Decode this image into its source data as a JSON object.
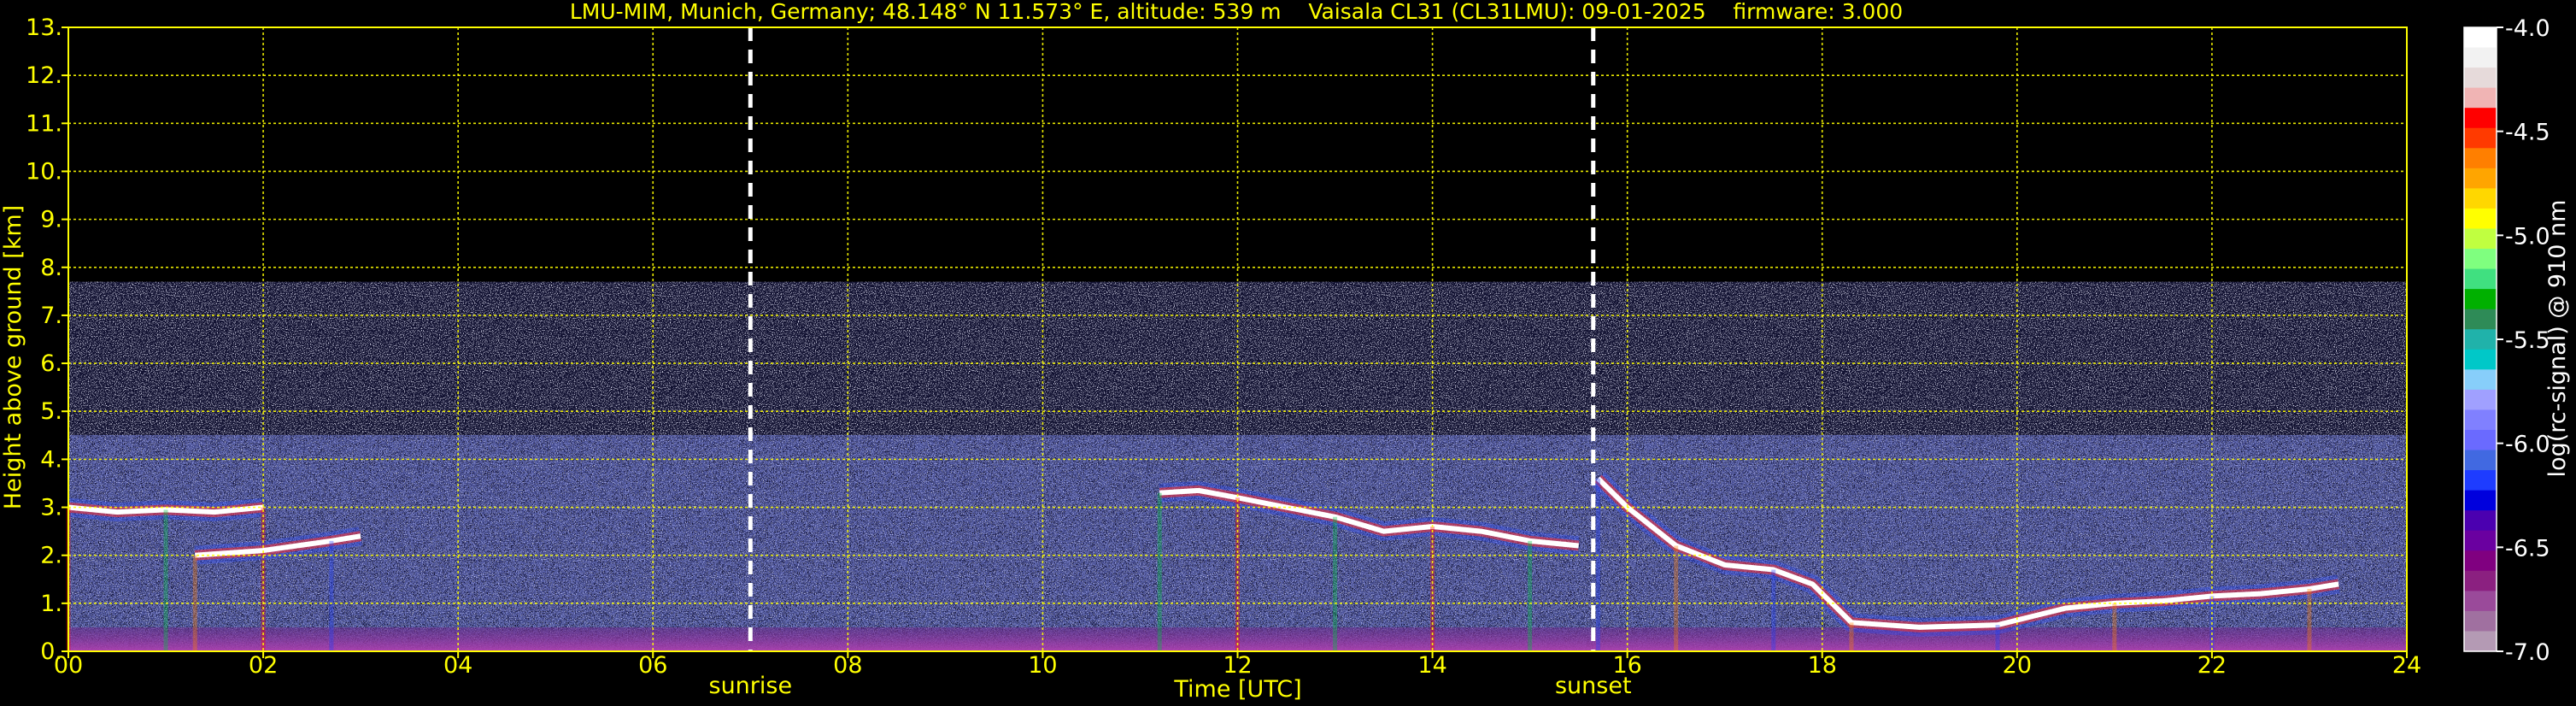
{
  "chart_data": {
    "type": "heatmap",
    "title": "LMU-MIM, Munich, Germany; 48.148° N 11.573° E, altitude: 539 m    Vaisala CL31 (CL31LMU): 09-01-2025    firmware: 3.000",
    "xlabel": "Time [UTC]",
    "ylabel": "Height above ground [km]",
    "xlim": [
      0,
      24
    ],
    "ylim": [
      0,
      13
    ],
    "x_ticks": [
      "00",
      "02",
      "04",
      "06",
      "08",
      "10",
      "12",
      "14",
      "16",
      "18",
      "20",
      "22",
      "24"
    ],
    "y_ticks": [
      "0.",
      "1.",
      "2.",
      "3.",
      "4.",
      "5.",
      "6.",
      "7.",
      "8.",
      "9.",
      "10.",
      "11.",
      "12.",
      "13."
    ],
    "grid": true,
    "grid_color": "#ffff00",
    "background": "#000000",
    "noise_top_km": 7.7,
    "markers": [
      {
        "label": "sunrise",
        "x": 7.0
      },
      {
        "label": "sunset",
        "x": 15.65
      }
    ],
    "colorbar": {
      "label": "log(rc-signal) @ 910 nm",
      "range": [
        -7.0,
        -4.0
      ],
      "ticks": [
        "-4.0",
        "-4.5",
        "-5.0",
        "-5.5",
        "-6.0",
        "-6.5",
        "-7.0"
      ],
      "colors": [
        "#ffffff",
        "#f2f2f2",
        "#e6dada",
        "#f0b4b4",
        "#ff0000",
        "#ff3a00",
        "#ff7f00",
        "#ffa500",
        "#ffd700",
        "#ffff00",
        "#c0ff40",
        "#7fff7f",
        "#40e080",
        "#00b000",
        "#2e8b57",
        "#20b2aa",
        "#00c8c8",
        "#87cefa",
        "#a0a0ff",
        "#8080ff",
        "#6a6aff",
        "#4169e1",
        "#1e3cff",
        "#0000dd",
        "#4b00b0",
        "#6a00a0",
        "#800080",
        "#8b2080",
        "#9a4a9a",
        "#a070a0",
        "#b49ab4"
      ]
    },
    "layers": [
      {
        "name": "cloud_layer",
        "points": [
          [
            0.0,
            3.0
          ],
          [
            0.5,
            2.9
          ],
          [
            1.0,
            2.95
          ],
          [
            1.5,
            2.9
          ],
          [
            2.0,
            3.0
          ]
        ]
      },
      {
        "name": "cloud_layer",
        "points": [
          [
            1.3,
            2.0
          ],
          [
            2.0,
            2.1
          ],
          [
            2.7,
            2.3
          ],
          [
            3.0,
            2.4
          ]
        ]
      },
      {
        "name": "cloud_layer",
        "points": [
          [
            11.2,
            3.3
          ],
          [
            11.6,
            3.35
          ],
          [
            12.0,
            3.2
          ],
          [
            12.5,
            3.0
          ],
          [
            13.0,
            2.8
          ],
          [
            13.5,
            2.5
          ],
          [
            14.0,
            2.6
          ],
          [
            14.5,
            2.5
          ],
          [
            15.0,
            2.3
          ],
          [
            15.5,
            2.2
          ]
        ]
      },
      {
        "name": "cloud_layer",
        "points": [
          [
            15.7,
            3.6
          ],
          [
            16.0,
            3.0
          ],
          [
            16.5,
            2.2
          ],
          [
            17.0,
            1.8
          ],
          [
            17.5,
            1.7
          ],
          [
            17.9,
            1.4
          ],
          [
            18.3,
            0.6
          ],
          [
            19.0,
            0.5
          ],
          [
            19.8,
            0.55
          ],
          [
            20.5,
            0.9
          ],
          [
            21.0,
            1.0
          ],
          [
            21.5,
            1.05
          ],
          [
            22.0,
            1.15
          ],
          [
            22.5,
            1.2
          ],
          [
            23.0,
            1.3
          ],
          [
            23.3,
            1.4
          ]
        ]
      }
    ]
  }
}
